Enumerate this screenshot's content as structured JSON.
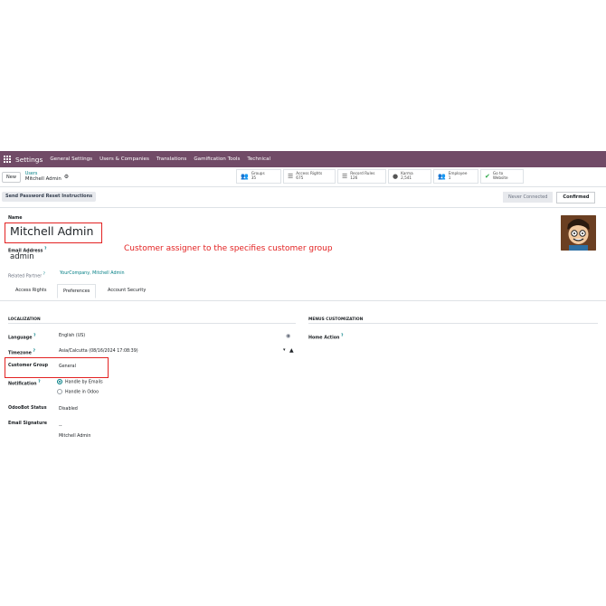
{
  "navbar": {
    "brand": "Settings",
    "menu": [
      "General Settings",
      "Users & Companies",
      "Translations",
      "Gamification Tools",
      "Technical"
    ]
  },
  "control_panel": {
    "new_label": "New",
    "breadcrumb_parent": "Users",
    "breadcrumb_current": "Mitchell Admin",
    "stats": [
      {
        "label": "Groups",
        "value": "35",
        "icon": "users-icon"
      },
      {
        "label": "Access Rights",
        "value": "675",
        "icon": "list-icon"
      },
      {
        "label": "Record Rules",
        "value": "126",
        "icon": "list-icon"
      },
      {
        "label": "Karma",
        "value": "2,541",
        "icon": "trophy-icon"
      },
      {
        "label": "Employee",
        "value": "1",
        "icon": "users-icon"
      },
      {
        "label": "Go to",
        "value": "Website",
        "icon": "globe-check-icon"
      }
    ]
  },
  "header": {
    "reset_button": "Send Password Reset Instructions",
    "status_never": "Never Connected",
    "status_confirmed": "Confirmed"
  },
  "form": {
    "name_label": "Name",
    "name_value": "Mitchell Admin",
    "email_label": "Email Address",
    "email_help": "?",
    "email_value": "admin",
    "related_partner_label": "Related Partner",
    "related_partner_help": "?",
    "related_partner_value": "YourCompany, Mitchell Admin",
    "annotation": "Customer assigner to the specifies customer group"
  },
  "tabs": [
    "Access Rights",
    "Preferences",
    "Account Security"
  ],
  "localization": {
    "title": "LOCALIZATION",
    "language_label": "Language",
    "language_help": "?",
    "language_value": "English (US)",
    "timezone_label": "Timezone",
    "timezone_help": "?",
    "timezone_value": "Asia/Calcutta (08/16/2024 17:08:39)",
    "customer_group_label": "Customer Group",
    "customer_group_value": "General",
    "notification_label": "Notification",
    "notification_help": "?",
    "notification_options": [
      "Handle by Emails",
      "Handle in Odoo"
    ],
    "notification_selected": "Handle by Emails",
    "odoobot_label": "OdooBot Status",
    "odoobot_value": "Disabled",
    "signature_label": "Email Signature",
    "signature_line1": "--",
    "signature_line2": "Mitchell Admin"
  },
  "menus_customization": {
    "title": "MENUS CUSTOMIZATION",
    "home_action_label": "Home Action",
    "home_action_help": "?"
  },
  "colors": {
    "navbar": "#714b67",
    "link": "#017e84",
    "annotation": "#e32222"
  }
}
